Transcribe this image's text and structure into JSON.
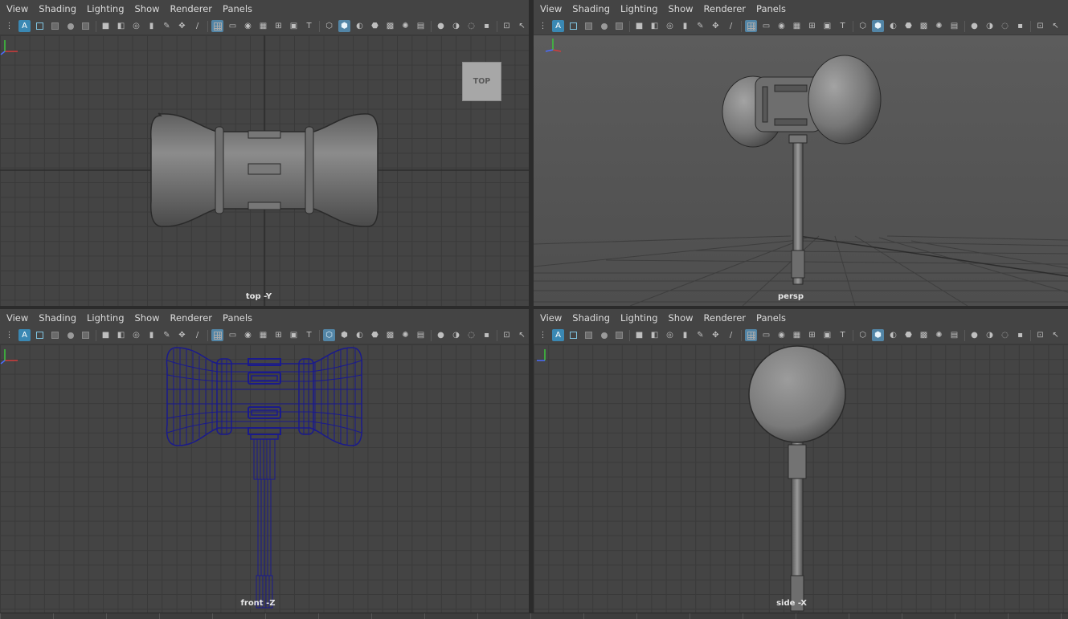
{
  "menu": [
    "View",
    "Shading",
    "Lighting",
    "Show",
    "Renderer",
    "Panels"
  ],
  "panes": {
    "top": {
      "camera_label": "top -Y",
      "viewcube_label": "TOP"
    },
    "persp": {
      "camera_label": "persp"
    },
    "front": {
      "camera_label": "front -Z"
    },
    "side": {
      "camera_label": "side -X"
    }
  },
  "axis_labels": {
    "x": "x",
    "y": "y",
    "z": "z"
  },
  "colors": {
    "viewport_bg": "#444444",
    "grid_line": "#3a3a3a",
    "wireframe": "#1a1a8c",
    "active_icon": "#3a88b3",
    "axis_x": "#d23c3c",
    "axis_y": "#3cc83c",
    "axis_z": "#4a6cff"
  },
  "toolbar_icons": [
    "select-camera-icon",
    "camera-attributes-icon",
    "bookmark-icon",
    "image-plane-icon",
    "2d-pan-zoom-icon",
    "grease-pencil-icon",
    "grid-icon",
    "film-gate-icon",
    "resolution-gate-icon",
    "gate-mask-icon",
    "field-chart-icon",
    "safe-action-icon",
    "safe-title-icon",
    "wireframe-icon",
    "smooth-shade-icon",
    "default-material-icon",
    "xray-icon",
    "xray-joints-icon",
    "lights-icon",
    "shadows-icon",
    "ambient-occlusion-icon",
    "motion-blur-icon",
    "anti-aliasing-icon",
    "depth-of-field-icon",
    "isolate-select-icon",
    "xray-active-icon"
  ]
}
